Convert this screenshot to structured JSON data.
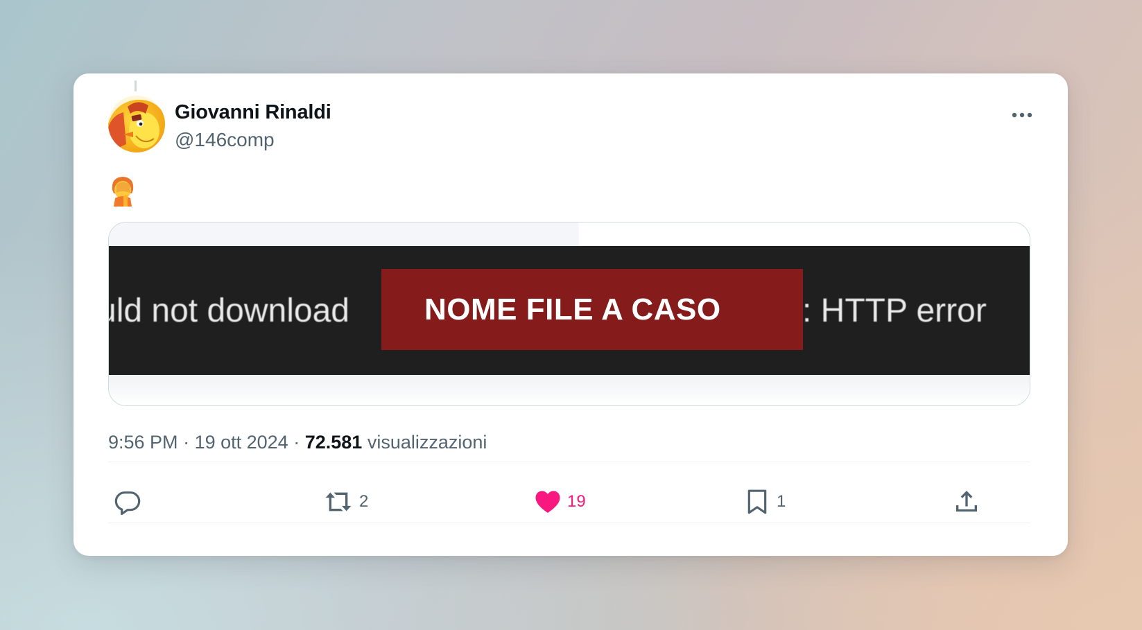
{
  "tweet": {
    "author": {
      "display_name": "Giovanni Rinaldi",
      "handle": "@146comp",
      "avatar_icon": "avatar-cartoon-bird-icon"
    },
    "more_icon": "more-dots-icon",
    "body_emoji_icon": "facepalm-emoji-icon",
    "media": {
      "text_left": "uld not download",
      "redacted_label": "NOME FILE A CASO",
      "text_right": ": HTTP error",
      "colors": {
        "bar": "#1f1f1f",
        "redaction": "#851b1b"
      }
    },
    "meta": {
      "time": "9:56 PM",
      "date": "19 ott 2024",
      "views_count": "72.581",
      "views_label": "visualizzazioni"
    },
    "actions": {
      "reply": {
        "icon": "reply-icon",
        "count": ""
      },
      "retweet": {
        "icon": "retweet-icon",
        "count": "2"
      },
      "like": {
        "icon": "heart-icon",
        "count": "19",
        "active": true,
        "color": "#f91880"
      },
      "bookmark": {
        "icon": "bookmark-icon",
        "count": "1"
      },
      "share": {
        "icon": "share-icon",
        "count": ""
      }
    }
  }
}
